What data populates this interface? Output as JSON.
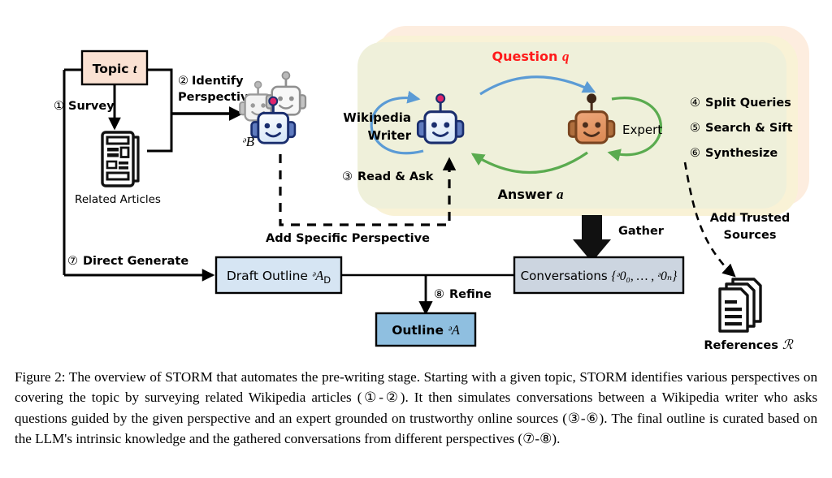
{
  "figure": {
    "label": "Figure 2",
    "caption": "Figure 2: The overview of STORM that automates the pre-writing stage. Starting with a given topic, STORM identifies various perspectives on covering the topic by surveying related Wikipedia articles (①-②). It then simulates conversations between a Wikipedia writer who asks questions guided by the given perspective and an expert grounded on trustworthy online sources (③-⑥). The final outline is curated based on the LLM's intrinsic knowledge and the gathered conversations from different perspectives (⑦-⑧)."
  },
  "nodes": {
    "topic": {
      "label": "Topic",
      "symbol": "t",
      "fill": "#fae1d2",
      "stroke": "#000000"
    },
    "related_articles": {
      "label": "Related Articles",
      "icon": "article-icon"
    },
    "perspectives": {
      "symbol": "ᵊB",
      "icon": "robot-group-icon"
    },
    "wikipedia_writer": {
      "line1": "Wikipedia",
      "line2": "Writer",
      "icon": "robot-blue-icon",
      "color": "#1a2e6e"
    },
    "expert": {
      "label": "Expert",
      "icon": "robot-orange-icon",
      "color": "#e09468"
    },
    "draft_outline": {
      "label": "Draft Outline",
      "symbol": "ᵊA",
      "subscript": "D",
      "fill": "#d6e5f3",
      "stroke": "#000000"
    },
    "conversations": {
      "label": "Conversations",
      "symbol": "{ᵊ0₀, … , ᵊ0ₙ}",
      "fill": "#ccd5e0",
      "stroke": "#000000"
    },
    "outline": {
      "label": "Outline",
      "symbol": "ᵊA",
      "fill": "#8fbfe0",
      "stroke": "#000000"
    },
    "references": {
      "label": "References",
      "symbol": "ℛ",
      "icon": "documents-stack-icon"
    }
  },
  "steps": [
    {
      "num": "①",
      "label": "Survey"
    },
    {
      "num": "②",
      "label": "Identify",
      "label2": "Perspectives"
    },
    {
      "num": "③",
      "label": "Read & Ask"
    },
    {
      "num": "④",
      "label": "Split Queries"
    },
    {
      "num": "⑤",
      "label": "Search & Sift"
    },
    {
      "num": "⑥",
      "label": "Synthesize"
    },
    {
      "num": "⑦",
      "label": "Direct Generate"
    },
    {
      "num": "⑧",
      "label": "Refine"
    }
  ],
  "edges": {
    "question": {
      "label": "Question",
      "symbol": "q",
      "color": "#ff1a1a",
      "arc_color": "#5b9bd5"
    },
    "answer": {
      "label": "Answer",
      "symbol": "a",
      "color": "#000000",
      "arc_color": "#5aab4f"
    },
    "add_specific_perspective": {
      "label": "Add Specific Perspective",
      "style": "dashed"
    },
    "add_trusted_sources": {
      "line1": "Add Trusted",
      "line2": "Sources",
      "style": "dashed"
    },
    "gather": {
      "label": "Gather",
      "style": "block-arrow"
    }
  },
  "panels": {
    "outer": {
      "fill": "#fdeddf"
    },
    "middle": {
      "fill": "#f7f2d8"
    },
    "inner": {
      "fill": "#eef0da"
    }
  }
}
